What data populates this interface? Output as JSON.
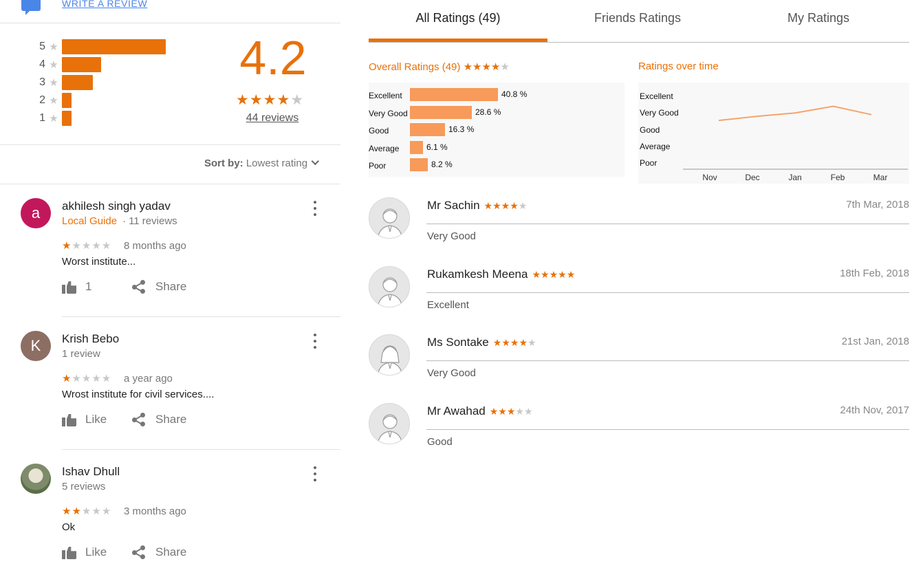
{
  "write_review": {
    "label": "WRITE A REVIEW"
  },
  "summary": {
    "histogram": [
      {
        "stars": "5",
        "fraction": 1.0
      },
      {
        "stars": "4",
        "fraction": 0.38
      },
      {
        "stars": "3",
        "fraction": 0.3
      },
      {
        "stars": "2",
        "fraction": 0.09
      },
      {
        "stars": "1",
        "fraction": 0.09
      }
    ],
    "score": "4.2",
    "score_stars": 4,
    "review_count": "44 reviews"
  },
  "sort": {
    "label": "Sort by:",
    "value": "Lowest rating"
  },
  "reviews": [
    {
      "avatar_letter": "a",
      "avatar_color": "#c2185b",
      "name": "akhilesh singh yadav",
      "guide": "Local Guide",
      "meta": "11 reviews",
      "stars": 1,
      "when": "8 months ago",
      "text": "Worst institute...",
      "like_label": "1",
      "share_label": "Share"
    },
    {
      "avatar_letter": "K",
      "avatar_color": "#8d6e63",
      "name": "Krish Bebo",
      "guide": "",
      "meta": "1 review",
      "stars": 1,
      "when": "a year ago",
      "text": "Wrost institute for civil services....",
      "like_label": "Like",
      "share_label": "Share"
    },
    {
      "avatar_letter": "",
      "avatar_color": "#7e8b6b",
      "name": "Ishav Dhull",
      "guide": "",
      "meta": "5 reviews",
      "stars": 2,
      "when": "3 months ago",
      "text": "Ok",
      "like_label": "Like",
      "share_label": "Share"
    }
  ],
  "tabs": {
    "all": "All Ratings (49)",
    "friends": "Friends Ratings",
    "my": "My Ratings"
  },
  "overall": {
    "title": "Overall Ratings (49)",
    "stars": 4,
    "chart_data": {
      "type": "bar",
      "orientation": "horizontal",
      "categories": [
        "Excellent",
        "Very Good",
        "Good",
        "Average",
        "Poor"
      ],
      "values": [
        40.8,
        28.6,
        16.3,
        6.1,
        8.2
      ],
      "value_labels": [
        "40.8 %",
        "28.6 %",
        "16.3 %",
        "6.1 %",
        "8.2 %"
      ],
      "bar_color": "#f79a5a"
    }
  },
  "over_time": {
    "title": "Ratings over time",
    "chart_data": {
      "type": "line",
      "x": [
        "Nov",
        "Dec",
        "Jan",
        "Feb",
        "Mar"
      ],
      "y_categories": [
        "Poor",
        "Average",
        "Good",
        "Very Good",
        "Excellent"
      ],
      "values": [
        3.55,
        3.8,
        4.0,
        4.4,
        3.9
      ],
      "line_color": "#f7a36b"
    }
  },
  "entries": [
    {
      "name": "Mr Sachin",
      "stars": 4,
      "date": "7th Mar, 2018",
      "label": "Very Good",
      "gender": "male"
    },
    {
      "name": "Rukamkesh Meena",
      "stars": 5,
      "date": "18th Feb, 2018",
      "label": "Excellent",
      "gender": "male"
    },
    {
      "name": "Ms Sontake",
      "stars": 4,
      "date": "21st Jan, 2018",
      "label": "Very Good",
      "gender": "female"
    },
    {
      "name": "Mr Awahad",
      "stars": 3,
      "date": "24th Nov, 2017",
      "label": "Good",
      "gender": "male"
    }
  ],
  "colors": {
    "accent": "#e8710a",
    "link": "#4a86e8"
  }
}
